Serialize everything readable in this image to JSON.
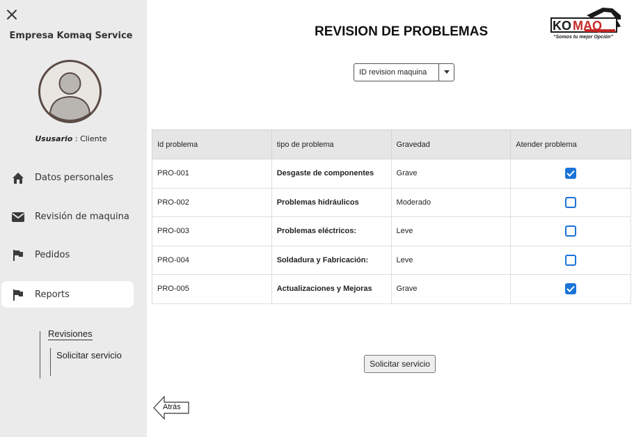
{
  "sidebar": {
    "company": "Empresa Komaq Service",
    "user_key": "Ususario",
    "user_sep": " : ",
    "user_role": "Cliente",
    "nav": [
      {
        "label": "Datos personales",
        "icon": "home-icon"
      },
      {
        "label": "Revisión de maquina",
        "icon": "mail-icon"
      },
      {
        "label": "Pedidos",
        "icon": "flag-icon"
      },
      {
        "label": "Reports",
        "icon": "flag-icon"
      }
    ],
    "subnav": {
      "revisiones": "Revisiones",
      "solicitar": "Solicitar servicio"
    }
  },
  "header": {
    "title": "REVISION DE PROBLEMAS",
    "logo_text": "KOMAQ",
    "logo_slogan": "“Somos tu mejor Opción”"
  },
  "filter": {
    "selected": "ID revision maquina"
  },
  "table": {
    "columns": [
      "Id problema",
      "tipo de problema",
      "Gravedad",
      "Atender problema"
    ],
    "rows": [
      {
        "id": "PRO-001",
        "type": "Desgaste de componentes",
        "severity": "Grave",
        "checked": true
      },
      {
        "id": "PRO-002",
        "type": "Problemas hidráulicos",
        "severity": "Moderado",
        "checked": false
      },
      {
        "id": "PRO-003",
        "type": "Problemas eléctricos:",
        "severity": "Leve",
        "checked": false
      },
      {
        "id": "PRO-004",
        "type": "Soldadura y Fabricación:",
        "severity": "Leve",
        "checked": false
      },
      {
        "id": "PRO-005",
        "type": "Actualizaciones y Mejoras",
        "severity": "Grave",
        "checked": true
      }
    ]
  },
  "actions": {
    "solicitar_label": "Solicitar servicio",
    "back_label": "Atrás"
  },
  "colors": {
    "sidebar_bg": "#ebebeb",
    "accent_blue": "#1a73d9",
    "logo_red": "#c62828"
  }
}
